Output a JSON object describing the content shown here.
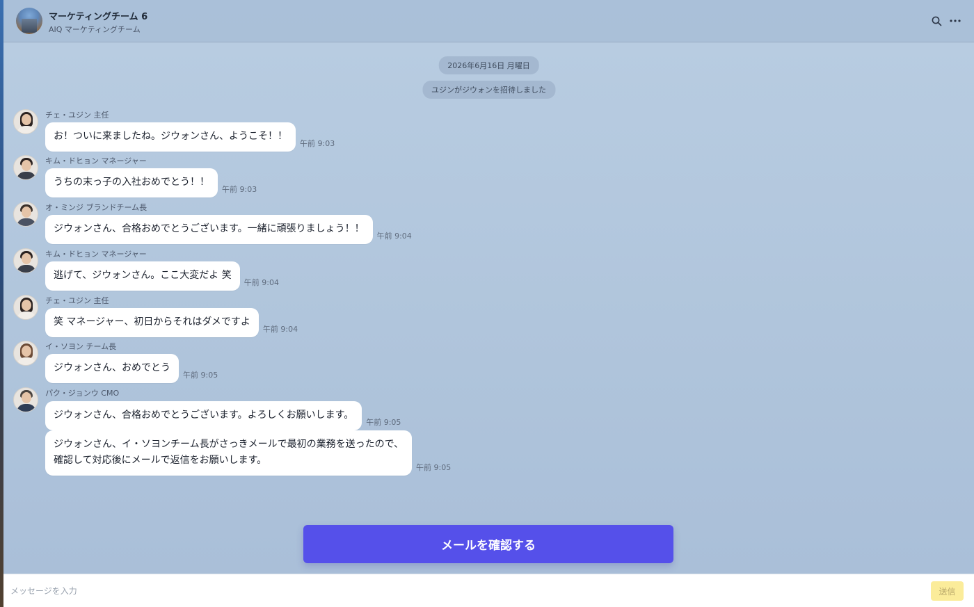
{
  "header": {
    "title": "マーケティングチーム 6",
    "subtitle": "AIQ マーケティングチーム"
  },
  "system": {
    "date": "2026年6月16日 月曜日",
    "event": "ユジンがジウォンを招待しました"
  },
  "messages": [
    {
      "sender": "チェ・ユジン 主任",
      "text": "お！ついに来ましたね。ジウォンさん、ようこそ！！",
      "time": "午前 9:03"
    },
    {
      "sender": "キム・ドヒョン マネージャー",
      "text": "うちの末っ子の入社おめでとう！！",
      "time": "午前 9:03"
    },
    {
      "sender": "オ・ミンジ ブランドチーム長",
      "text": "ジウォンさん、合格おめでとうございます。一緒に頑張りましょう！！",
      "time": "午前 9:04"
    },
    {
      "sender": "キム・ドヒョン マネージャー",
      "text": "逃げて、ジウォンさん。ここ大変だよ 笑",
      "time": "午前 9:04"
    },
    {
      "sender": "チェ・ユジン 主任",
      "text": "笑 マネージャー、初日からそれはダメですよ",
      "time": "午前 9:04"
    },
    {
      "sender": "イ・ソヨン チーム長",
      "text": "ジウォンさん、おめでとう",
      "time": "午前 9:05"
    },
    {
      "sender": "パク・ジョンウ CMO",
      "text": "ジウォンさん、合格おめでとうございます。よろしくお願いします。",
      "time": "午前 9:05"
    },
    {
      "sender": "",
      "text_line1": "ジウォンさん、イ・ソヨンチーム長がさっきメールで最初の業務を送ったので、",
      "text_line2": "確認して対応後にメールで返信をお願いします。",
      "time": "午前 9:05"
    }
  ],
  "cta": {
    "label": "メールを確認する"
  },
  "composer": {
    "placeholder": "メッセージを入力",
    "send_label": "送信"
  },
  "icons": {
    "search": "search-icon",
    "more": "more-icon"
  }
}
